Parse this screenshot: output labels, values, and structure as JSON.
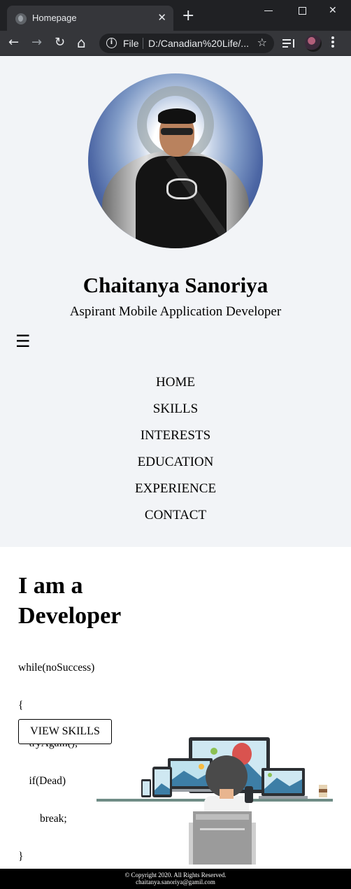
{
  "browser": {
    "tab_title": "Homepage",
    "tab_close": "✕",
    "new_tab": "+",
    "window_close": "✕",
    "omnibox_scheme": "File",
    "omnibox_url": "D:/Canadian%20Life/...",
    "omnibox_info": "i",
    "bookmark_star": "☆",
    "nav_back": "←",
    "nav_forward": "→",
    "nav_reload": "↻",
    "nav_home": "⌂"
  },
  "profile": {
    "name": "Chaitanya Sanoriya",
    "tagline": "Aspirant Mobile Application Developer"
  },
  "menu_icon": "☰",
  "nav": [
    "HOME",
    "SKILLS",
    "INTERESTS",
    "EDUCATION",
    "EXPERIENCE",
    "CONTACT"
  ],
  "hero": {
    "headline_line1": "I am a",
    "headline_line2": "Developer",
    "code_lines": [
      "while(noSuccess)",
      "{",
      "    tryAgain();",
      "    if(Dead)",
      "        break;",
      "}"
    ],
    "button_label": "VIEW SKILLS"
  },
  "footer": {
    "copyright": "© Copyright 2020. All Rights Reserved.",
    "email": "chaitanya.sanoriya@gamil.com"
  },
  "colors": {
    "chrome_dark": "#202124",
    "chrome_toolbar": "#35363a",
    "header_bg": "#f2f4f7",
    "footer_bg": "#000000"
  }
}
